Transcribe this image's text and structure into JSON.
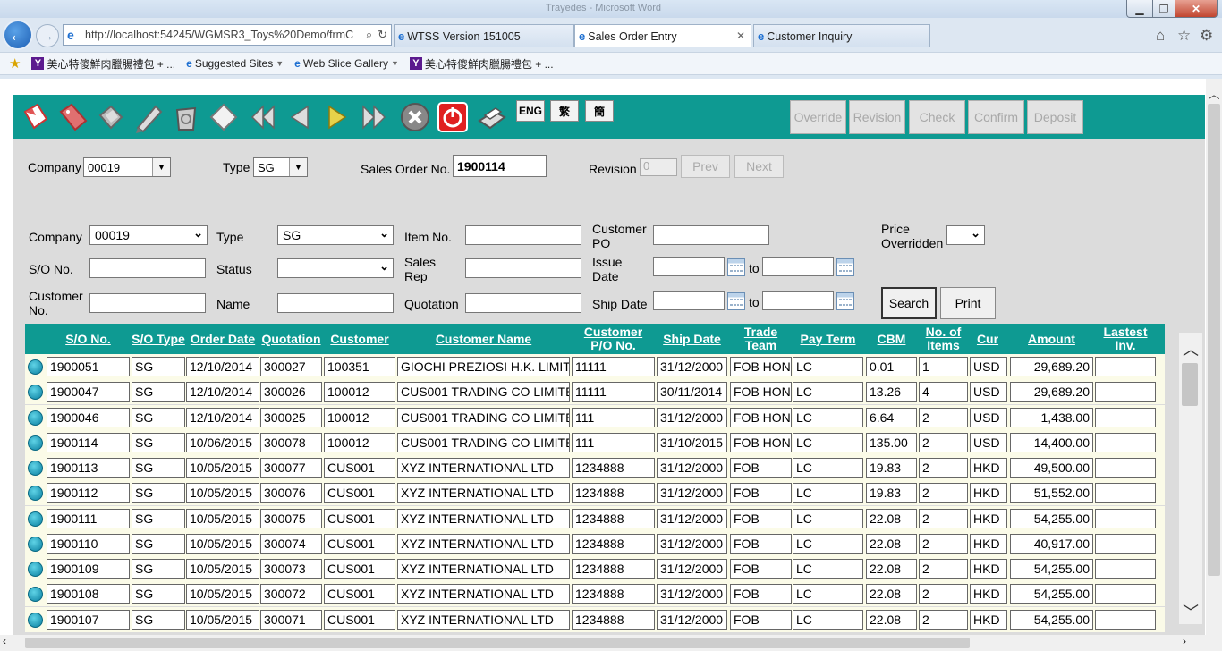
{
  "browser": {
    "window_title": "Trayedes - Microsoft Word",
    "address": "http://localhost:54245/WGMSR3_Toys%20Demo/frmC",
    "tabs": [
      {
        "label": "WTSS Version 151005"
      },
      {
        "label": "Sales Order Entry"
      },
      {
        "label": "Customer Inquiry"
      }
    ],
    "favorites": [
      {
        "label": "美心特傻鮮肉臘腸禮包 + ..."
      },
      {
        "label": "Suggested Sites"
      },
      {
        "label": "Web Slice Gallery"
      },
      {
        "label": "美心特傻鮮肉臘腸禮包 + ..."
      }
    ]
  },
  "toolbar": {
    "lang_buttons": [
      "ENG",
      "繁",
      "簡"
    ],
    "workflow_buttons": [
      "Override",
      "Revision",
      "Check",
      "Confirm",
      "Deposit"
    ],
    "accent_color": "#0e9a92"
  },
  "header_form": {
    "company_label": "Company",
    "company_value": "00019",
    "type_label": "Type",
    "type_value": "SG",
    "so_no_label": "Sales Order No.",
    "so_no_value": "1900114",
    "revision_label": "Revision",
    "revision_value": "0",
    "prev_label": "Prev",
    "next_label": "Next"
  },
  "filters": {
    "company_label": "Company",
    "company_value": "00019",
    "type_label": "Type",
    "type_value": "SG",
    "item_no_label": "Item No.",
    "customer_po_label": "Customer PO",
    "price_overridden_label": "Price Overridden",
    "so_no_label": "S/O No.",
    "status_label": "Status",
    "sales_rep_label": "Sales Rep",
    "issue_date_label": "Issue Date",
    "to_label": "to",
    "customer_no_label": "Customer No.",
    "name_label": "Name",
    "quotation_label": "Quotation",
    "ship_date_label": "Ship Date",
    "search_label": "Search",
    "print_label": "Print"
  },
  "grid": {
    "columns": [
      "S/O No.",
      "S/O Type",
      "Order Date",
      "Quotation",
      "Customer",
      "Customer Name",
      "Customer P/O No.",
      "Ship Date",
      "Trade Team",
      "Pay Term",
      "CBM",
      "No. of Items",
      "Cur",
      "Amount",
      "Lastest Inv."
    ],
    "rows": [
      [
        "1900051",
        "SG",
        "12/10/2014",
        "300027",
        "100351",
        "GIOCHI PREZIOSI H.K. LIMIT",
        "11111",
        "31/12/2000",
        "FOB HON",
        "LC",
        "0.01",
        "1",
        "USD",
        "29,689.20",
        ""
      ],
      [
        "1900047",
        "SG",
        "12/10/2014",
        "300026",
        "100012",
        "CUS001 TRADING CO LIMITE",
        "11111",
        "30/11/2014",
        "FOB HON",
        "LC",
        "13.26",
        "4",
        "USD",
        "29,689.20",
        ""
      ],
      [
        "1900046",
        "SG",
        "12/10/2014",
        "300025",
        "100012",
        "CUS001 TRADING CO LIMITE",
        "111",
        "31/12/2000",
        "FOB HON",
        "LC",
        "6.64",
        "2",
        "USD",
        "1,438.00",
        ""
      ],
      [
        "1900114",
        "SG",
        "10/06/2015",
        "300078",
        "100012",
        "CUS001 TRADING CO LIMITE",
        "111",
        "31/10/2015",
        "FOB HON",
        "LC",
        "135.00",
        "2",
        "USD",
        "14,400.00",
        ""
      ],
      [
        "1900113",
        "SG",
        "10/05/2015",
        "300077",
        "CUS001",
        "XYZ INTERNATIONAL LTD",
        "1234888",
        "31/12/2000",
        "FOB",
        "LC",
        "19.83",
        "2",
        "HKD",
        "49,500.00",
        ""
      ],
      [
        "1900112",
        "SG",
        "10/05/2015",
        "300076",
        "CUS001",
        "XYZ INTERNATIONAL LTD",
        "1234888",
        "31/12/2000",
        "FOB",
        "LC",
        "19.83",
        "2",
        "HKD",
        "51,552.00",
        ""
      ],
      [
        "1900111",
        "SG",
        "10/05/2015",
        "300075",
        "CUS001",
        "XYZ INTERNATIONAL LTD",
        "1234888",
        "31/12/2000",
        "FOB",
        "LC",
        "22.08",
        "2",
        "HKD",
        "54,255.00",
        ""
      ],
      [
        "1900110",
        "SG",
        "10/05/2015",
        "300074",
        "CUS001",
        "XYZ INTERNATIONAL LTD",
        "1234888",
        "31/12/2000",
        "FOB",
        "LC",
        "22.08",
        "2",
        "HKD",
        "40,917.00",
        ""
      ],
      [
        "1900109",
        "SG",
        "10/05/2015",
        "300073",
        "CUS001",
        "XYZ INTERNATIONAL LTD",
        "1234888",
        "31/12/2000",
        "FOB",
        "LC",
        "22.08",
        "2",
        "HKD",
        "54,255.00",
        ""
      ],
      [
        "1900108",
        "SG",
        "10/05/2015",
        "300072",
        "CUS001",
        "XYZ INTERNATIONAL LTD",
        "1234888",
        "31/12/2000",
        "FOB",
        "LC",
        "22.08",
        "2",
        "HKD",
        "54,255.00",
        ""
      ],
      [
        "1900107",
        "SG",
        "10/05/2015",
        "300071",
        "CUS001",
        "XYZ INTERNATIONAL LTD",
        "1234888",
        "31/12/2000",
        "FOB",
        "LC",
        "22.08",
        "2",
        "HKD",
        "54,255.00",
        ""
      ]
    ]
  }
}
